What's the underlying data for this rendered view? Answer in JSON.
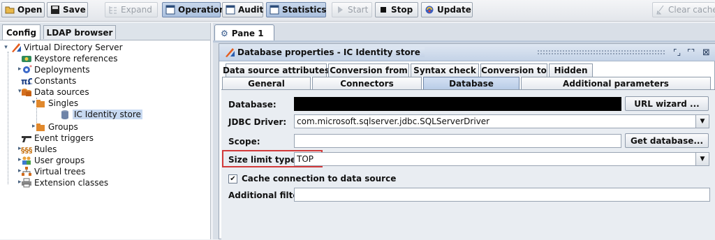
{
  "toolbar": {
    "open": "Open",
    "save": "Save",
    "expand": "Expand",
    "operation": "Operation",
    "audit": "Audit",
    "statistics": "Statistics",
    "start": "Start",
    "stop": "Stop",
    "update": "Update",
    "clear_cache": "Clear cache"
  },
  "left_tabs": {
    "config": "Config",
    "ldap_browser": "LDAP browser"
  },
  "tree": {
    "root": "Virtual Directory Server",
    "keystore": "Keystore references",
    "deployments": "Deployments",
    "constants": "Constants",
    "data_sources": "Data sources",
    "singles": "Singles",
    "ic_identity_store": "IC Identity store",
    "groups": "Groups",
    "event_triggers": "Event triggers",
    "rules": "Rules",
    "user_groups": "User groups",
    "virtual_trees": "Virtual trees",
    "extension_classes": "Extension classes"
  },
  "pane_tab": "Pane 1",
  "frame_title": "Database properties - IC Identity store",
  "tabs_row1": [
    "Data source attributes",
    "Conversion from",
    "Syntax check",
    "Conversion to",
    "Hidden"
  ],
  "tabs_row2": [
    "General",
    "Connectors",
    "Database",
    "Additional parameters"
  ],
  "form": {
    "database_label": "Database:",
    "url_wizard": "URL wizard ...",
    "jdbc_label": "JDBC Driver:",
    "jdbc_value": "com.microsoft.sqlserver.jdbc.SQLServerDriver",
    "scope_label": "Scope:",
    "get_database": "Get database...",
    "size_limit_label": "Size limit type:",
    "size_limit_value": "TOP",
    "cache_label": "Cache connection to data source",
    "additional_filter_label": "Additional filter:"
  },
  "colors": {
    "highlight_box": "#d23a3a",
    "selected_tab": "#b7cbe6",
    "redacted": "#000000"
  }
}
